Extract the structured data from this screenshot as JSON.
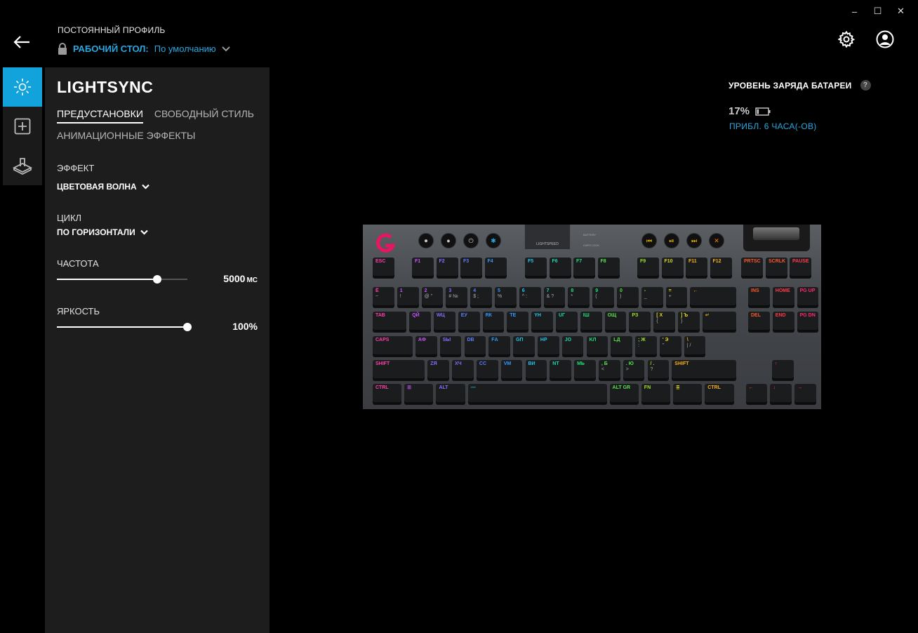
{
  "window_controls": {
    "minimize": "–",
    "maximize": "☐",
    "close": "✕"
  },
  "header": {
    "profile_caption": "ПОСТОЯННЫЙ ПРОФИЛЬ",
    "profile_name": "РАБОЧИЙ СТОЛ:",
    "profile_value": "По умолчанию"
  },
  "rail": {
    "items": [
      "lightsync-icon",
      "assignments-icon",
      "game-mode-icon"
    ],
    "active_index": 0
  },
  "panel": {
    "title": "LIGHTSYNC",
    "tabs": [
      "ПРЕДУСТАНОВКИ",
      "СВОБОДНЫЙ СТИЛЬ",
      "АНИМАЦИОННЫЕ ЭФФЕКТЫ"
    ],
    "active_tab": 0,
    "effect": {
      "label": "ЭФФЕКТ",
      "value": "ЦВЕТОВАЯ ВОЛНА"
    },
    "cycle": {
      "label": "ЦИКЛ",
      "value": "ПО ГОРИЗОНТАЛИ"
    },
    "frequency": {
      "label": "ЧАСТОТА",
      "value": "5000",
      "unit": "МС",
      "level": 0.77
    },
    "brightness": {
      "label": "ЯРКОСТЬ",
      "value": "100%",
      "level": 1.0
    }
  },
  "battery": {
    "title": "УРОВЕНЬ ЗАРЯДА БАТАРЕИ",
    "help": "?",
    "percent": "17%",
    "estimate": "ПРИБЛ. 6 ЧАСА(-ОВ)"
  },
  "keyboard": {
    "lightspeed_label": "LIGHTSPEED",
    "indicators": [
      "BATTERY",
      "CAPS LOCK"
    ],
    "rows": [
      [
        [
          "ESC",
          ""
        ],
        [
          "F1",
          ""
        ],
        [
          "F2",
          ""
        ],
        [
          "F3",
          ""
        ],
        [
          "F4",
          ""
        ],
        [
          "F5",
          ""
        ],
        [
          "F6",
          ""
        ],
        [
          "F7",
          ""
        ],
        [
          "F8",
          ""
        ],
        [
          "F9",
          ""
        ],
        [
          "F10",
          ""
        ],
        [
          "F11",
          ""
        ],
        [
          "F12",
          ""
        ],
        [
          "PRTSC",
          ""
        ],
        [
          "SCRLK",
          ""
        ],
        [
          "PAUSE",
          ""
        ]
      ],
      [
        [
          "Ё",
          "~"
        ],
        [
          "1",
          "!"
        ],
        [
          "2",
          "@ \""
        ],
        [
          "3",
          "# №"
        ],
        [
          "4",
          "$ ;"
        ],
        [
          "5",
          "%"
        ],
        [
          "6",
          "^ :"
        ],
        [
          "7",
          "& ?"
        ],
        [
          "8",
          "*"
        ],
        [
          "9",
          "("
        ],
        [
          "0",
          ")"
        ],
        [
          "-",
          "_"
        ],
        [
          "=",
          "+"
        ],
        [
          "←",
          ""
        ],
        [
          "INS",
          ""
        ],
        [
          "HOME",
          ""
        ],
        [
          "PG UP",
          ""
        ]
      ],
      [
        [
          "TAB",
          ""
        ],
        [
          "QЙ",
          ""
        ],
        [
          "WЦ",
          ""
        ],
        [
          "EУ",
          ""
        ],
        [
          "RК",
          ""
        ],
        [
          "TЕ",
          ""
        ],
        [
          "YН",
          ""
        ],
        [
          "UГ",
          ""
        ],
        [
          "IШ",
          ""
        ],
        [
          "OЩ",
          ""
        ],
        [
          "PЗ",
          ""
        ],
        [
          "[ Х",
          "{"
        ],
        [
          "] Ъ",
          "}"
        ],
        [
          "↵",
          ""
        ],
        [
          "DEL",
          ""
        ],
        [
          "END",
          ""
        ],
        [
          "PG DN",
          ""
        ]
      ],
      [
        [
          "CAPS",
          ""
        ],
        [
          "AФ",
          ""
        ],
        [
          "SЫ",
          ""
        ],
        [
          "DВ",
          ""
        ],
        [
          "FА",
          ""
        ],
        [
          "GП",
          ""
        ],
        [
          "HР",
          ""
        ],
        [
          "JО",
          ""
        ],
        [
          "KЛ",
          ""
        ],
        [
          "LД",
          ""
        ],
        [
          "; Ж",
          ":"
        ],
        [
          "' Э",
          "\""
        ],
        [
          "\\",
          "| /"
        ]
      ],
      [
        [
          "SHIFT",
          ""
        ],
        [
          "ZЯ",
          ""
        ],
        [
          "XЧ",
          ""
        ],
        [
          "CС",
          ""
        ],
        [
          "VМ",
          ""
        ],
        [
          "BИ",
          ""
        ],
        [
          "NТ",
          ""
        ],
        [
          "MЬ",
          ""
        ],
        [
          ", Б",
          "<"
        ],
        [
          ". Ю",
          ">"
        ],
        [
          "/ .",
          "?"
        ],
        [
          "SHIFT",
          ""
        ],
        [
          "↑",
          ""
        ]
      ],
      [
        [
          "CTRL",
          ""
        ],
        [
          "⊞",
          ""
        ],
        [
          "ALT",
          ""
        ],
        [
          "—",
          ""
        ],
        [
          "ALT GR",
          ""
        ],
        [
          "FN",
          ""
        ],
        [
          "≣",
          ""
        ],
        [
          "CTRL",
          ""
        ],
        [
          "←",
          ""
        ],
        [
          "↓",
          ""
        ],
        [
          "→",
          ""
        ]
      ]
    ]
  }
}
